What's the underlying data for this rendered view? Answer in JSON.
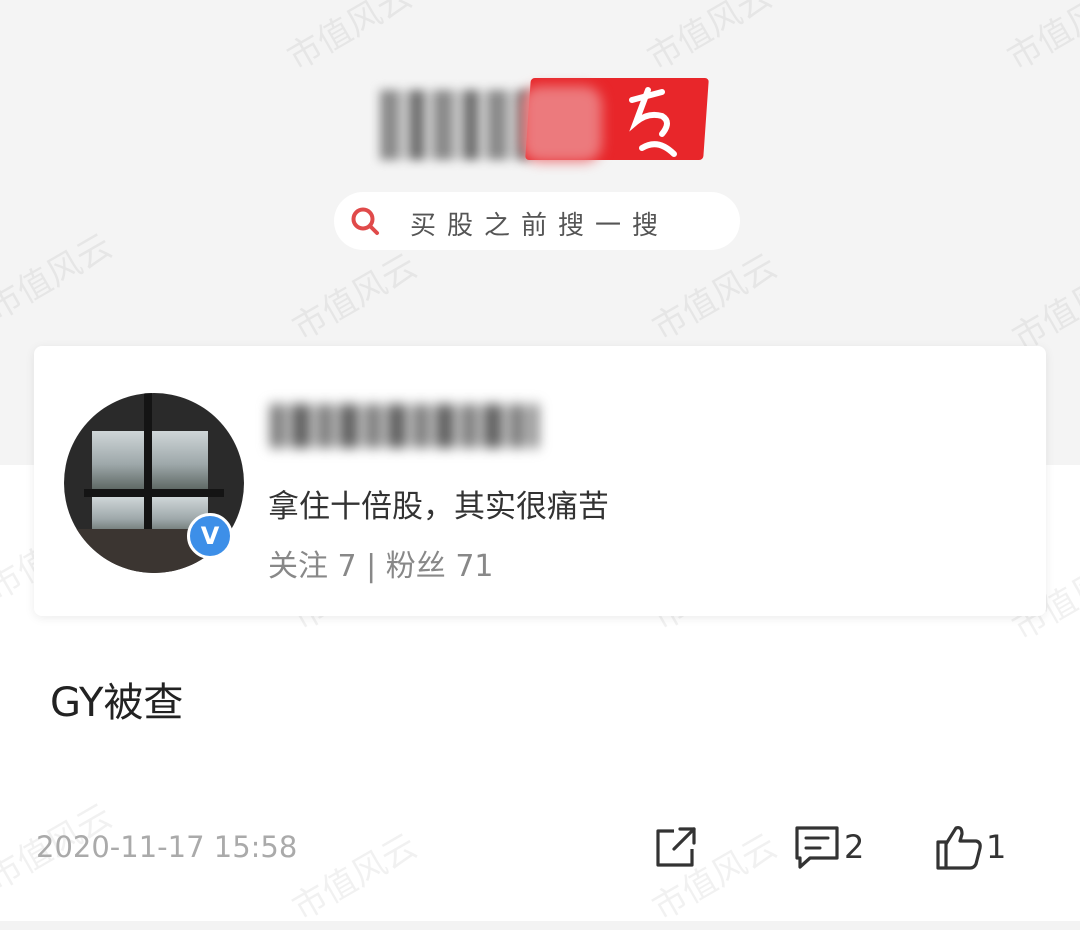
{
  "search": {
    "placeholder": "买股之前搜一搜"
  },
  "profile": {
    "bio": "拿住十倍股，其实很痛苦",
    "stats": "关注 7 | 粉丝 71",
    "verified_badge": "V"
  },
  "post": {
    "text": "GY被查",
    "timestamp": "2020-11-17 15:58",
    "comment_count": "2",
    "like_count": "1"
  },
  "watermark": {
    "text": "市值风云"
  },
  "colors": {
    "brand_red": "#e8262a",
    "verified_blue": "#3d8fe8",
    "search_icon_red": "#e04a4a"
  },
  "icons": [
    "search-icon",
    "share-icon",
    "comment-icon",
    "thumbs-up-icon",
    "verified-icon"
  ]
}
